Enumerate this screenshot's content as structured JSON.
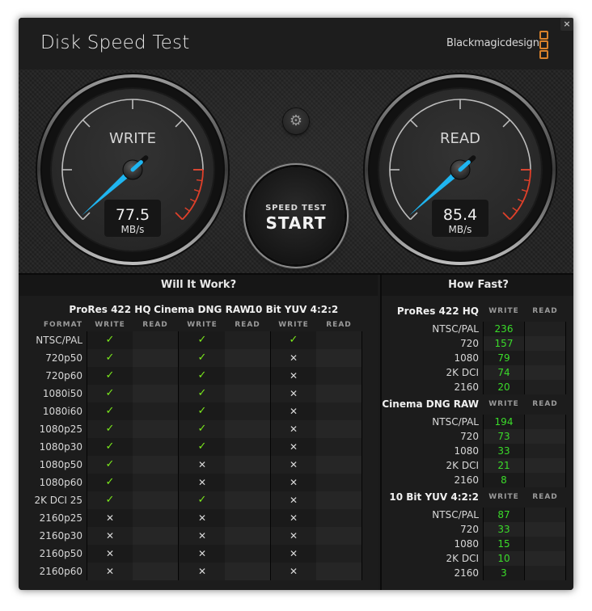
{
  "window": {
    "title": "Disk Speed Test",
    "brand": "Blackmagicdesign",
    "close_label": "×"
  },
  "colors": {
    "needle": "#1fb5f0",
    "redline": "#e0402a",
    "check": "#7bea1c",
    "speed_value": "#3bdc2a",
    "brand_logo": "#d9822b"
  },
  "gauges": {
    "write": {
      "label": "WRITE",
      "value": "77.5",
      "unit": "MB/s",
      "needle_fraction": 0.0
    },
    "read": {
      "label": "READ",
      "value": "85.4",
      "unit": "MB/s",
      "needle_fraction": 0.0
    }
  },
  "controls": {
    "settings_icon": "gear-icon",
    "start_sub": "SPEED TEST",
    "start_main": "START"
  },
  "will_it_work": {
    "header": "Will It Work?",
    "format_header": "FORMAT",
    "groups": [
      {
        "name": "ProRes 422 HQ",
        "write": "WRITE",
        "read": "READ"
      },
      {
        "name": "Cinema DNG RAW",
        "write": "WRITE",
        "read": "READ"
      },
      {
        "name": "10 Bit YUV 4:2:2",
        "write": "WRITE",
        "read": "READ"
      }
    ],
    "rows": [
      {
        "format": "NTSC/PAL",
        "prores_write": "✓",
        "dng_write": "✓",
        "yuv_write": "✓"
      },
      {
        "format": "720p50",
        "prores_write": "✓",
        "dng_write": "✓",
        "yuv_write": "✕"
      },
      {
        "format": "720p60",
        "prores_write": "✓",
        "dng_write": "✓",
        "yuv_write": "✕"
      },
      {
        "format": "1080i50",
        "prores_write": "✓",
        "dng_write": "✓",
        "yuv_write": "✕"
      },
      {
        "format": "1080i60",
        "prores_write": "✓",
        "dng_write": "✓",
        "yuv_write": "✕"
      },
      {
        "format": "1080p25",
        "prores_write": "✓",
        "dng_write": "✓",
        "yuv_write": "✕"
      },
      {
        "format": "1080p30",
        "prores_write": "✓",
        "dng_write": "✓",
        "yuv_write": "✕"
      },
      {
        "format": "1080p50",
        "prores_write": "✓",
        "dng_write": "✕",
        "yuv_write": "✕"
      },
      {
        "format": "1080p60",
        "prores_write": "✓",
        "dng_write": "✕",
        "yuv_write": "✕"
      },
      {
        "format": "2K DCI 25",
        "prores_write": "✓",
        "dng_write": "✓",
        "yuv_write": "✕"
      },
      {
        "format": "2160p25",
        "prores_write": "✕",
        "dng_write": "✕",
        "yuv_write": "✕"
      },
      {
        "format": "2160p30",
        "prores_write": "✕",
        "dng_write": "✕",
        "yuv_write": "✕"
      },
      {
        "format": "2160p50",
        "prores_write": "✕",
        "dng_write": "✕",
        "yuv_write": "✕"
      },
      {
        "format": "2160p60",
        "prores_write": "✕",
        "dng_write": "✕",
        "yuv_write": "✕"
      }
    ]
  },
  "how_fast": {
    "header": "How Fast?",
    "write_header": "WRITE",
    "read_header": "READ",
    "groups": [
      {
        "name": "ProRes 422 HQ",
        "rows": [
          {
            "label": "NTSC/PAL",
            "write": "236",
            "read": ""
          },
          {
            "label": "720",
            "write": "157",
            "read": ""
          },
          {
            "label": "1080",
            "write": "79",
            "read": ""
          },
          {
            "label": "2K DCI",
            "write": "74",
            "read": ""
          },
          {
            "label": "2160",
            "write": "20",
            "read": ""
          }
        ]
      },
      {
        "name": "Cinema DNG RAW",
        "rows": [
          {
            "label": "NTSC/PAL",
            "write": "194",
            "read": ""
          },
          {
            "label": "720",
            "write": "73",
            "read": ""
          },
          {
            "label": "1080",
            "write": "33",
            "read": ""
          },
          {
            "label": "2K DCI",
            "write": "21",
            "read": ""
          },
          {
            "label": "2160",
            "write": "8",
            "read": ""
          }
        ]
      },
      {
        "name": "10 Bit YUV 4:2:2",
        "rows": [
          {
            "label": "NTSC/PAL",
            "write": "87",
            "read": ""
          },
          {
            "label": "720",
            "write": "33",
            "read": ""
          },
          {
            "label": "1080",
            "write": "15",
            "read": ""
          },
          {
            "label": "2K DCI",
            "write": "10",
            "read": ""
          },
          {
            "label": "2160",
            "write": "3",
            "read": ""
          }
        ]
      }
    ]
  }
}
